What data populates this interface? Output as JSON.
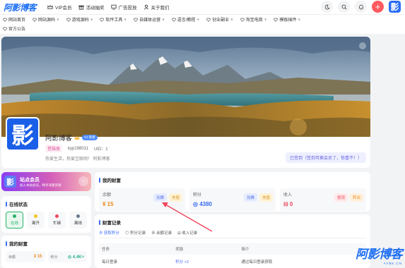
{
  "topbar": {
    "logo": "阿影博客",
    "nav": [
      {
        "label": "VIP会员",
        "icon": "crown-icon"
      },
      {
        "label": "活动抽奖",
        "icon": "gift-icon"
      },
      {
        "label": "广告投放",
        "icon": "monitor-icon"
      },
      {
        "label": "关于我们",
        "icon": "user-icon"
      }
    ],
    "avatar_text": "影",
    "plus_label": "+"
  },
  "categories": {
    "row1": [
      "网站首页",
      "网站源码",
      "游戏源码",
      "软件工具",
      "自媒体运营",
      "语言/教程",
      "创业副业",
      "淘宝电商",
      "模板插件"
    ],
    "row2": [
      "官方公告"
    ]
  },
  "profile": {
    "avatar_text": "影",
    "name": "阿影博客",
    "badge": "V1 新星",
    "gender": "登猫类",
    "uid_label": "kyp198011",
    "uid": "UID：1",
    "desc": "热爱生活，热爱互联网！ 阿影博客",
    "checkin": "已签到（签到可换会员了，惊喜不！）"
  },
  "vip": {
    "icon_text": "影",
    "title": "站点会员",
    "subtitle": "加入本站会员，畅享海量资源",
    "arrow": "›"
  },
  "online": {
    "title": "在线状态",
    "items": [
      {
        "label": "在线",
        "color": "#26b36b"
      },
      {
        "label": "离开",
        "color": "#f5c323"
      },
      {
        "label": "忙碌",
        "color": "#f0465a"
      },
      {
        "label": "离线",
        "color": "#6a7a8a"
      }
    ]
  },
  "mywealth_left": {
    "title": "我的财富",
    "items": [
      {
        "label": "余额",
        "value": "¥ 15",
        "color": "#ee8a1b"
      },
      {
        "label": "积分",
        "value": "◎ 4.4K+",
        "color": "#2ab48c"
      }
    ]
  },
  "wealth": {
    "title": "我的财富",
    "balance": {
      "label": "余额",
      "value": "¥ 15",
      "btn1": "兑换",
      "btn2": "充值"
    },
    "points": {
      "label": "积分",
      "value": "◎ 4380",
      "btn1": "兑换",
      "btn2": "充值"
    },
    "income": {
      "label": "收入",
      "value": "⊟ 0",
      "btn1": "提现",
      "btn2": "转出"
    }
  },
  "records": {
    "title": "财富记录",
    "tabs": [
      "获取积分",
      "积分记录",
      "余额记录",
      "收入记录"
    ],
    "columns": [
      "任务",
      "奖励",
      "简介"
    ],
    "rows": [
      {
        "task": "每日登录",
        "reward": "积分 +2",
        "desc": "通过每日登录获取"
      }
    ]
  },
  "watermark": {
    "main": "阿影博客",
    "sub": "AYBK.CN"
  },
  "colors": {
    "accent": "#3b6cf6",
    "brand": "#1e6ff3",
    "arrow": "#f0465a"
  }
}
